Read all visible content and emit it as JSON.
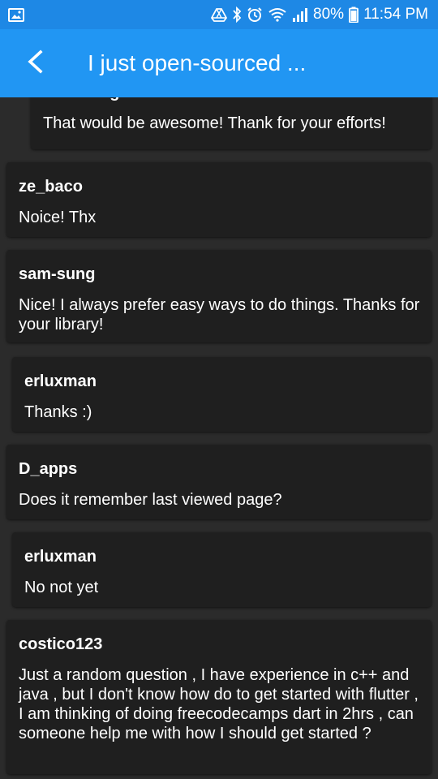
{
  "status_bar": {
    "battery": "80%",
    "time": "11:54 PM"
  },
  "app_bar": {
    "title": "I just open-sourced ..."
  },
  "comments": [
    {
      "author": "sam-sung",
      "text": "That would be awesome! Thank for your efforts!"
    },
    {
      "author": "ze_baco",
      "text": "Noice! Thx"
    },
    {
      "author": "sam-sung",
      "text": "Nice! I always prefer easy ways to do things. Thanks for your library!"
    },
    {
      "author": "erluxman",
      "text": "Thanks :)"
    },
    {
      "author": "D_apps",
      "text": "Does it remember last viewed page?"
    },
    {
      "author": "erluxman",
      "text": "No not yet"
    },
    {
      "author": "costico123",
      "text": "Just a random question , I have experience in c++ and java , but  I don't know how do to get started with flutter , I am thinking of doing freecodecamps dart in 2hrs , can someone help me with how I should get started ?"
    }
  ],
  "icons": {
    "status_left": "image-icon",
    "status_right": [
      "drive-icon",
      "bluetooth-icon",
      "alarm-icon",
      "wifi-icon",
      "signal-icon",
      "battery-icon"
    ],
    "back": "back-arrow-icon"
  }
}
